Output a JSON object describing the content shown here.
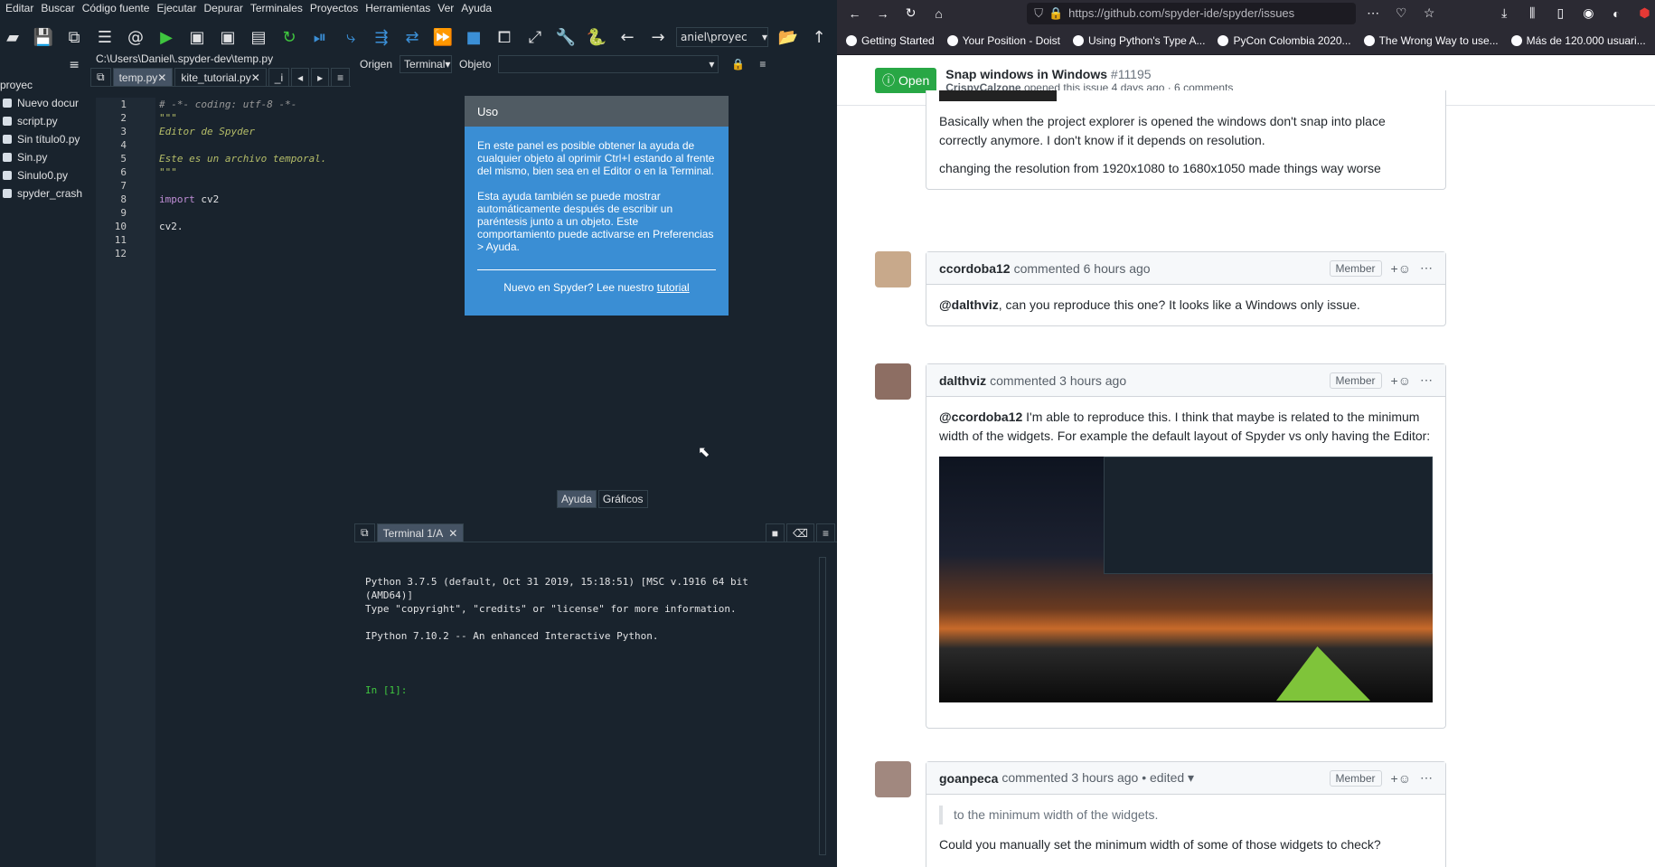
{
  "spyder": {
    "menu": [
      "Editar",
      "Buscar",
      "Código fuente",
      "Ejecutar",
      "Depurar",
      "Terminales",
      "Proyectos",
      "Herramientas",
      "Ver",
      "Ayuda"
    ],
    "toolbar": {
      "working_dir": "aniel\\proyec"
    },
    "file_tree": {
      "root": "proyec",
      "items": [
        "Nuevo docur",
        "script.py",
        "Sin título0.py",
        "Sin.py",
        "Sinulo0.py",
        "spyder_crash"
      ]
    },
    "editor": {
      "path": "C:\\Users\\Daniel\\.spyder-dev\\temp.py",
      "tabs": [
        "temp.py",
        "kite_tutorial.py",
        "_i"
      ],
      "lines": [
        {
          "n": "1",
          "t": "# -*- coding: utf-8 -*-",
          "k": "comment"
        },
        {
          "n": "2",
          "t": "\"\"\"",
          "k": "str"
        },
        {
          "n": "3",
          "t": "Editor de Spyder",
          "k": "str"
        },
        {
          "n": "4",
          "t": "",
          "k": "str"
        },
        {
          "n": "5",
          "t": "Este es un archivo temporal.",
          "k": "str"
        },
        {
          "n": "6",
          "t": "\"\"\"",
          "k": "str"
        },
        {
          "n": "7",
          "t": "",
          "k": "def"
        },
        {
          "n": "8",
          "t": "import cv2",
          "k": "import"
        },
        {
          "n": "9",
          "t": "",
          "k": "def"
        },
        {
          "n": "10",
          "t": "cv2.",
          "k": "def"
        },
        {
          "n": "11",
          "t": "",
          "k": "def"
        },
        {
          "n": "12",
          "t": "",
          "k": "def"
        }
      ]
    },
    "help": {
      "origin_label": "Origen",
      "origin_value": "Terminal",
      "object_label": "Objeto",
      "card_title": "Uso",
      "p1": "En este panel es posible obtener la ayuda de cualquier objeto al oprimir Ctrl+I estando al frente del mismo, bien sea en el Editor o en la Terminal.",
      "p2": "Esta ayuda también se puede mostrar automáticamente después de escribir un paréntesis junto a un objeto. Este comportamiento puede activarse en Preferencias > Ayuda.",
      "footer_text": "Nuevo en Spyder? Lee nuestro ",
      "footer_link": "tutorial",
      "tabs": [
        "Ayuda",
        "Gráficos"
      ]
    },
    "console": {
      "tab": "Terminal 1/A",
      "lines": [
        "Python 3.7.5 (default, Oct 31 2019, 15:18:51) [MSC v.1916 64 bit",
        "(AMD64)]",
        "Type \"copyright\", \"credits\" or \"license\" for more information.",
        "",
        "IPython 7.10.2 -- An enhanced Interactive Python.",
        ""
      ],
      "prompt": "In [1]:"
    }
  },
  "browser": {
    "url": "https://github.com/spyder-ide/spyder/issues",
    "bookmarks": [
      "Getting Started",
      "Your Position - Doist",
      "Using Python's Type A...",
      "PyCon Colombia 2020...",
      "The Wrong Way to use...",
      "Más de 120.000 usuari..."
    ],
    "issue": {
      "state": "Open",
      "title": "Snap windows in Windows",
      "number": "#11195",
      "author": "CrispyCalzone",
      "meta": "opened this issue 4 days ago · 6 comments"
    },
    "comments": [
      {
        "body1": "Basically when the project explorer is opened the windows don't snap into place correctly anymore. I don't know if it depends on resolution.",
        "body2": "changing the resolution from 1920x1080 to 1680x1050 made things way worse"
      },
      {
        "author": "ccordoba12",
        "time": "commented 6 hours ago",
        "badge": "Member",
        "mention": "@dalthviz",
        "body": ", can you reproduce this one? It looks like a Windows only issue."
      },
      {
        "author": "dalthviz",
        "time": "commented 3 hours ago",
        "badge": "Member",
        "mention": "@ccordoba12",
        "body": " I'm able to reproduce this. I think that maybe is related to the minimum width of the widgets. For example the default layout of Spyder vs only having the Editor:"
      },
      {
        "author": "goanpeca",
        "time": "commented 3 hours ago • edited ▾",
        "badge": "Member",
        "quote": "to the minimum width of the widgets.",
        "body": "Could you manually set the minimum width of some of those widgets to check?"
      }
    ]
  }
}
